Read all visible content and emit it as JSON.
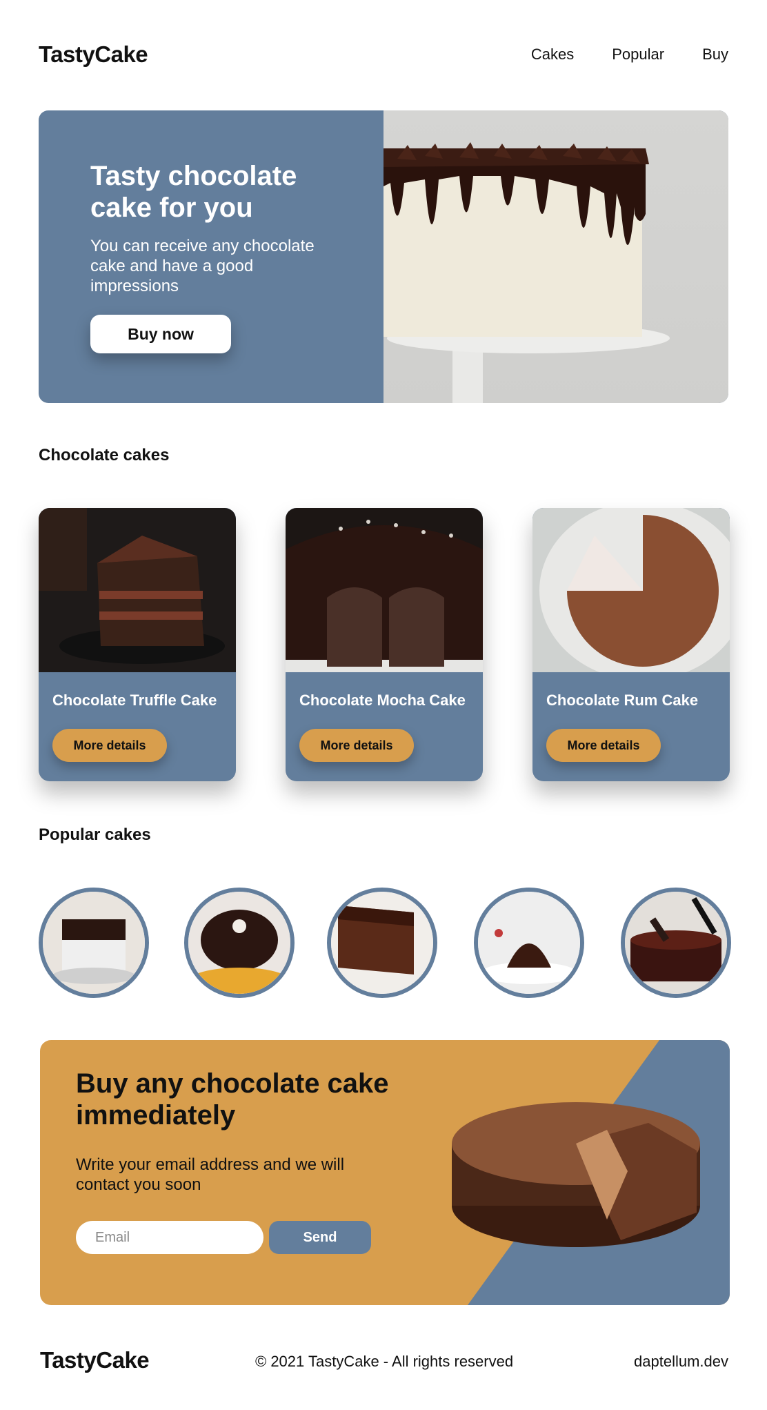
{
  "brand": "TastyCake",
  "nav": {
    "items": [
      "Cakes",
      "Popular",
      "Buy"
    ]
  },
  "hero": {
    "title": "Tasty chocolate cake for you",
    "subtitle": "You can receive any chocolate cake and have a good impressions",
    "button": "Buy now"
  },
  "chocolate_section": {
    "title": "Chocolate cakes",
    "cards": [
      {
        "title": "Chocolate Truffle Cake",
        "button": "More details"
      },
      {
        "title": "Chocolate Mocha Cake",
        "button": "More details"
      },
      {
        "title": "Chocolate Rum Cake",
        "button": "More details"
      }
    ]
  },
  "popular_section": {
    "title": "Popular cakes"
  },
  "cta": {
    "title": "Buy any chocolate cake immediately",
    "subtitle": "Write your email address and we will contact you soon",
    "email_placeholder": "Email",
    "send_label": "Send"
  },
  "footer": {
    "logo": "TastyCake",
    "copyright": "© 2021 TastyCake - All rights reserved",
    "link": "daptellum.dev"
  },
  "colors": {
    "primary_blue": "#637e9c",
    "accent_orange": "#d89e4d",
    "text": "#111111",
    "background": "#ffffff"
  }
}
